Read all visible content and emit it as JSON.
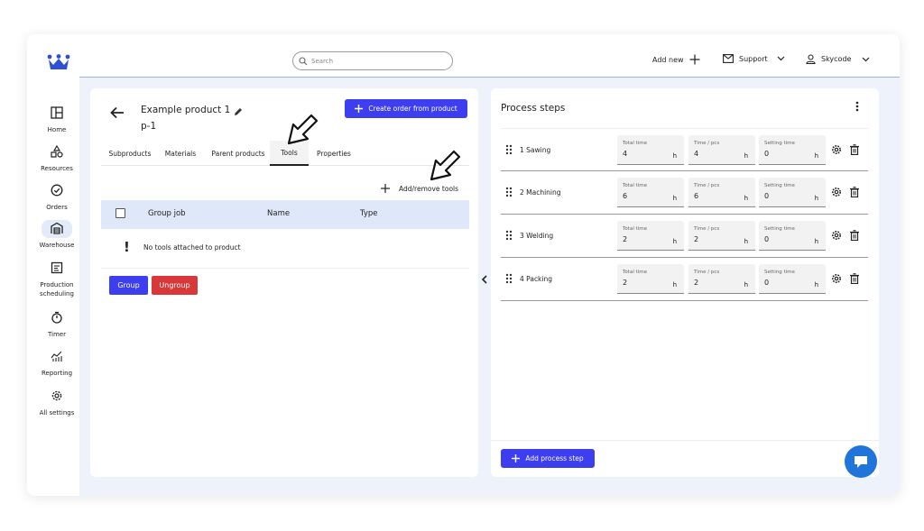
{
  "sidebar": {
    "items": [
      {
        "label": "Home",
        "icon": "dashboard-icon"
      },
      {
        "label": "Resources",
        "icon": "shapes-icon"
      },
      {
        "label": "Orders",
        "icon": "check-circle-icon"
      },
      {
        "label": "Warehouse",
        "icon": "warehouse-icon"
      },
      {
        "label": "Production",
        "label2": "scheduling",
        "icon": "schedule-icon"
      },
      {
        "label": "Timer",
        "icon": "timer-icon"
      },
      {
        "label": "Reporting",
        "icon": "chart-icon"
      },
      {
        "label": "All settings",
        "icon": "gear-icon"
      }
    ]
  },
  "topbar": {
    "search_placeholder": "Search",
    "add_new": "Add new",
    "support": "Support",
    "user": "Skycode"
  },
  "product": {
    "title_line1": "Example product 1",
    "title_line2": "p-1",
    "create_order": "Create order from product"
  },
  "tabs": [
    {
      "label": "Subproducts"
    },
    {
      "label": "Materials"
    },
    {
      "label": "Parent products"
    },
    {
      "label": "Tools",
      "active": true
    },
    {
      "label": "Properties"
    }
  ],
  "tools": {
    "add_remove": "Add/remove tools",
    "columns": [
      "Group job",
      "Name",
      "Type"
    ],
    "empty_message": "No tools attached to product",
    "group_button": "Group",
    "ungroup_button": "Ungroup"
  },
  "process": {
    "title": "Process steps",
    "field_labels": {
      "total": "Total time",
      "per_pcs": "Time / pcs",
      "setting": "Setting time"
    },
    "unit": "h",
    "steps": [
      {
        "name": "1 Sawing",
        "total": "4",
        "per_pcs": "4",
        "setting": "0"
      },
      {
        "name": "2 Machining",
        "total": "6",
        "per_pcs": "6",
        "setting": "0"
      },
      {
        "name": "3 Welding",
        "total": "2",
        "per_pcs": "2",
        "setting": "0"
      },
      {
        "name": "4 Packing",
        "total": "2",
        "per_pcs": "2",
        "setting": "0"
      }
    ],
    "add_step": "Add process step"
  },
  "colors": {
    "primary": "#3c3ef0",
    "danger": "#d9383a",
    "header_bg": "#dfe8f8",
    "chat": "#1f75d9"
  }
}
